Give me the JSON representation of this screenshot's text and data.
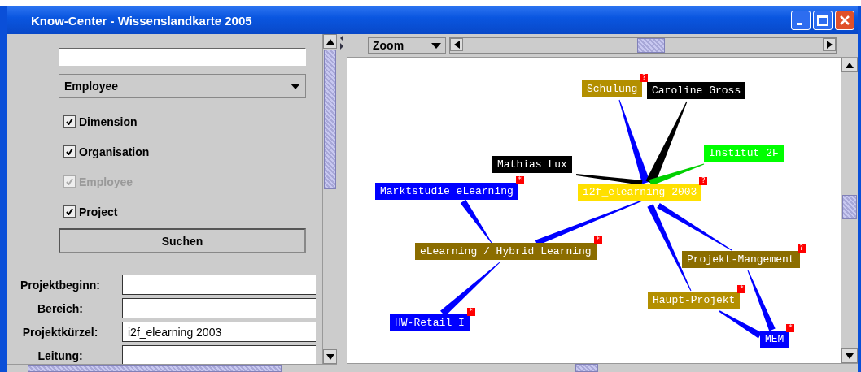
{
  "window": {
    "title": "Know-Center - Wissenslandkarte 2005"
  },
  "search_panel": {
    "type_dropdown": "Employee",
    "checkboxes": [
      {
        "label": "Dimension",
        "checked": true,
        "disabled": false
      },
      {
        "label": "Organisation",
        "checked": true,
        "disabled": false
      },
      {
        "label": "Employee",
        "checked": true,
        "disabled": true
      },
      {
        "label": "Project",
        "checked": true,
        "disabled": false
      }
    ],
    "search_button": "Suchen",
    "details": [
      {
        "label": "Projektbeginn:"
      },
      {
        "label": "Bereich:"
      },
      {
        "label": "Projektkürzel:",
        "value": "i2f_elearning 2003"
      },
      {
        "label": "Leitung:"
      }
    ]
  },
  "map": {
    "zoom_dropdown": "Zoom",
    "nodes": [
      {
        "label": "Schulung",
        "color": "#b38f00",
        "badge": "?"
      },
      {
        "label": "Caroline Gross",
        "color": "#000000"
      },
      {
        "label": "Mathias Lux",
        "color": "#000000"
      },
      {
        "label": "Institut 2F",
        "color": "#00ff00"
      },
      {
        "label": "Marktstudie eLearning",
        "color": "#0000ff",
        "badge": "*"
      },
      {
        "label": "i2f_elearning 2003",
        "color": "#ffe000",
        "badge": "?"
      },
      {
        "label": "eLearning / Hybrid Learning",
        "color": "#8b6d00",
        "badge": "*"
      },
      {
        "label": "Projekt-Mangement",
        "color": "#8b6d00",
        "badge": "?"
      },
      {
        "label": "Haupt-Projekt",
        "color": "#b38f00",
        "badge": "*"
      },
      {
        "label": "HW-Retail I",
        "color": "#0000ff",
        "badge": "*"
      },
      {
        "label": "MEM",
        "color": "#0000ff",
        "badge": "*"
      }
    ]
  }
}
